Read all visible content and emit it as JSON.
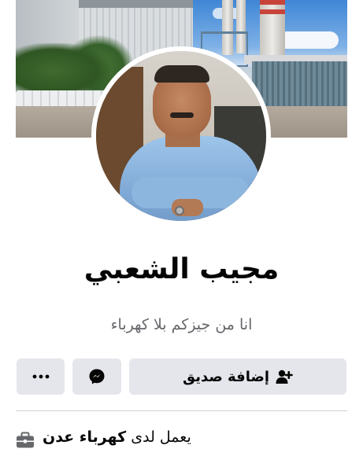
{
  "profile": {
    "name": "مجيب الشعبي",
    "bio": "انا من جيزكم بلا كهرباء"
  },
  "actions": {
    "add_friend_label": "إضافة صديق",
    "add_friend_icon": "person-add-icon",
    "messenger_icon": "messenger-icon",
    "more_icon": "more-dots-icon",
    "more_glyph": "···"
  },
  "intro": {
    "work_prefix": "يعمل لدى",
    "work_employer": "كهرباء عدن",
    "work_icon": "briefcase-icon"
  },
  "colors": {
    "button_bg": "#e4e6eb",
    "secondary_text": "#65676b",
    "primary_text": "#050505",
    "divider": "#ced0d4"
  }
}
